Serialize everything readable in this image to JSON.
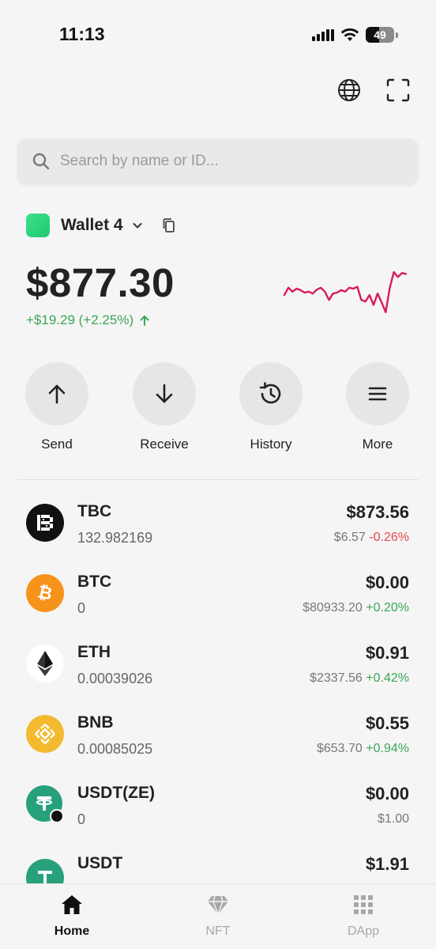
{
  "status_bar": {
    "time": "11:13",
    "battery": "49"
  },
  "top_actions": [
    "globe-icon",
    "scan-icon"
  ],
  "search": {
    "placeholder": "Search by name or ID..."
  },
  "wallet": {
    "name": "Wallet 4",
    "balance": "$877.30",
    "change": "+$19.29 (+2.25%)",
    "change_color": "#3aa757",
    "sparkline_color": "#d81b60",
    "sparkline": [
      0.45,
      0.6,
      0.52,
      0.58,
      0.55,
      0.5,
      0.52,
      0.48,
      0.56,
      0.6,
      0.52,
      0.35,
      0.48,
      0.5,
      0.55,
      0.52,
      0.6,
      0.58,
      0.62,
      0.35,
      0.32,
      0.45,
      0.25,
      0.48,
      0.3,
      0.1,
      0.6,
      0.92,
      0.82,
      0.9,
      0.88
    ]
  },
  "actions": [
    {
      "label": "Send",
      "icon": "arrow-up-icon"
    },
    {
      "label": "Receive",
      "icon": "arrow-down-icon"
    },
    {
      "label": "History",
      "icon": "history-icon"
    },
    {
      "label": "More",
      "icon": "menu-icon"
    }
  ],
  "assets": [
    {
      "symbol": "TBC",
      "qty": "132.982169",
      "value": "$873.56",
      "price": "$6.57",
      "pct": "-0.26%",
      "pct_dir": "neg",
      "logo_bg": "#111111"
    },
    {
      "symbol": "BTC",
      "qty": "0",
      "value": "$0.00",
      "price": "$80933.20",
      "pct": "+0.20%",
      "pct_dir": "pos",
      "logo_bg": "#f7931a"
    },
    {
      "symbol": "ETH",
      "qty": "0.00039026",
      "value": "$0.91",
      "price": "$2337.56",
      "pct": "+0.42%",
      "pct_dir": "pos",
      "logo_bg": "#ffffff"
    },
    {
      "symbol": "BNB",
      "qty": "0.00085025",
      "value": "$0.55",
      "price": "$653.70",
      "pct": "+0.94%",
      "pct_dir": "pos",
      "logo_bg": "#f3ba2f"
    },
    {
      "symbol": "USDT(ZE)",
      "qty": "0",
      "value": "$0.00",
      "price": "$1.00",
      "pct": "",
      "pct_dir": "pos",
      "logo_bg": "#26a17b"
    },
    {
      "symbol": "USDT",
      "qty": "",
      "value": "$1.91",
      "price": "",
      "pct": "",
      "pct_dir": "pos",
      "logo_bg": "#26a17b"
    }
  ],
  "tabs": [
    {
      "label": "Home",
      "active": true
    },
    {
      "label": "NFT",
      "active": false
    },
    {
      "label": "DApp",
      "active": false
    }
  ]
}
